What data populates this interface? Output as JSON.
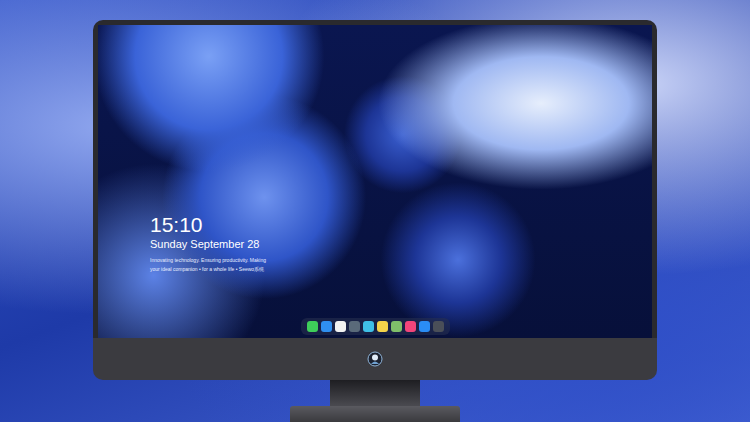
{
  "desktop": {
    "clock": {
      "time": "15:10",
      "date": "Sunday September 28",
      "lines": [
        "Innovating technology. Ensuring productivity. Making",
        "your ideal companion • for a whole life • Seewo系统"
      ]
    }
  },
  "dock": {
    "apps": [
      {
        "color": "#3ecf5a"
      },
      {
        "color": "#2f8ff0"
      },
      {
        "color": "#f2f2f2"
      },
      {
        "color": "#5a6a7a"
      },
      {
        "color": "#3fc0e8"
      },
      {
        "color": "#f4d34a"
      },
      {
        "color": "#7fbf6a"
      },
      {
        "color": "#f2457a"
      },
      {
        "color": "#2a8cf5"
      },
      {
        "color": "#4a4f58"
      }
    ]
  }
}
